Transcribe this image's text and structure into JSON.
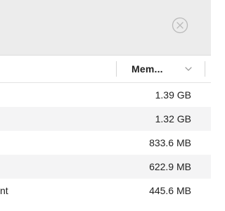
{
  "toolbar": {
    "stop_icon": "xmark-circle-icon"
  },
  "columns": {
    "memory_label": "Mem...",
    "sort_icon": "chevron-down-icon"
  },
  "rows": [
    {
      "name": "",
      "memory": "1.39 GB"
    },
    {
      "name": "",
      "memory": "1.32 GB"
    },
    {
      "name": "",
      "memory": "833.6 MB"
    },
    {
      "name": "",
      "memory": "622.9 MB"
    },
    {
      "name": "nt",
      "memory": "445.6 MB"
    }
  ],
  "colors": {
    "toolbar_bg": "#ececec",
    "row_alt_bg": "#f4f4f5",
    "text": "#222222"
  }
}
